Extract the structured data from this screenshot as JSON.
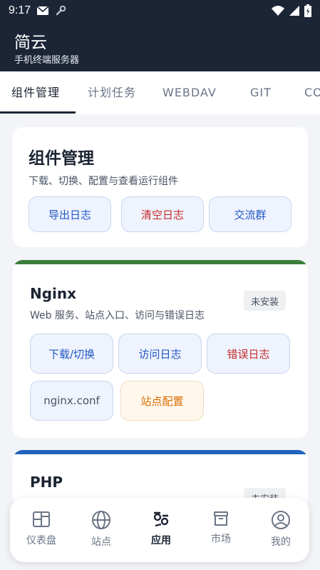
{
  "status_bar": {
    "time": "9:17"
  },
  "app": {
    "title": "简云",
    "subtitle": "手机终端服务器"
  },
  "tabs": [
    {
      "label": "组件管理",
      "active": true
    },
    {
      "label": "计划任务",
      "active": false
    },
    {
      "label": "WEBDAV",
      "active": false
    },
    {
      "label": "GIT",
      "active": false
    },
    {
      "label": "CO",
      "active": false
    }
  ],
  "component_card": {
    "title": "组件管理",
    "description": "下载、切换、配置与查看运行组件",
    "buttons": {
      "export_log": "导出日志",
      "clear_log": "清空日志",
      "group_chat": "交流群"
    }
  },
  "nginx_card": {
    "accent": "#3a7d3a",
    "title": "Nginx",
    "status": "未安装",
    "description": "Web 服务、站点入口、访问与错误日志",
    "buttons": {
      "download": "下载/切换",
      "access_log": "访问日志",
      "error_log": "错误日志",
      "nginx_conf": "nginx.conf",
      "site_config": "站点配置"
    }
  },
  "php_card": {
    "accent": "#1f63bd",
    "title": "PHP",
    "status": "未安装"
  },
  "bottom_nav": [
    {
      "label": "仪表盘",
      "icon": "dashboard-icon",
      "active": false
    },
    {
      "label": "站点",
      "icon": "globe-icon",
      "active": false
    },
    {
      "label": "应用",
      "icon": "apps-icon",
      "active": true
    },
    {
      "label": "市场",
      "icon": "store-icon",
      "active": false
    },
    {
      "label": "我的",
      "icon": "profile-icon",
      "active": false
    }
  ]
}
